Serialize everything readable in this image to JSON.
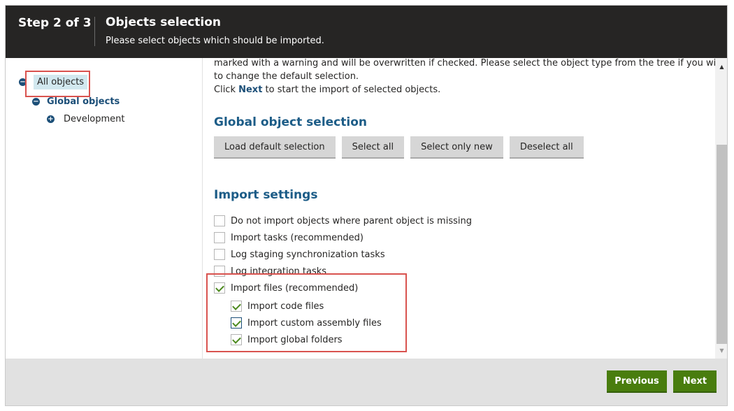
{
  "header": {
    "step": "Step 2 of 3",
    "title": "Objects selection",
    "subtitle": "Please select objects which should be imported."
  },
  "tree": {
    "root": {
      "label": "All objects",
      "toggle": "−"
    },
    "child": {
      "label": "Global objects",
      "toggle": "−"
    },
    "grandchild": {
      "label": "Development",
      "toggle": "+"
    }
  },
  "intro": {
    "line1": "marked with a warning and will be overwritten if checked. Please select the object type from the tree if you wish",
    "line2": "to change the default selection.",
    "line3_prefix": "Click ",
    "line3_bold": "Next",
    "line3_suffix": " to start the import of selected objects."
  },
  "global_selection": {
    "title": "Global object selection",
    "buttons": [
      "Load default selection",
      "Select all",
      "Select only new",
      "Deselect all"
    ]
  },
  "import_settings": {
    "title": "Import settings",
    "options": [
      {
        "label": "Do not import objects where parent object is missing",
        "checked": false
      },
      {
        "label": "Import tasks (recommended)",
        "checked": false
      },
      {
        "label": "Log staging synchronization tasks",
        "checked": false
      },
      {
        "label": "Log integration tasks",
        "checked": false
      },
      {
        "label": "Import files (recommended)",
        "checked": true
      },
      {
        "label": "Import code files",
        "checked": true
      },
      {
        "label": "Import custom assembly files",
        "checked": true
      },
      {
        "label": "Import global folders",
        "checked": true
      }
    ]
  },
  "scrollbar": {
    "up": "▲",
    "down": "▼"
  },
  "footer": {
    "previous": "Previous",
    "next": "Next"
  },
  "colors": {
    "header_bg": "#262524",
    "accent": "#1c5c87",
    "primary_button": "#497d0e",
    "highlight": "#d9534f"
  }
}
